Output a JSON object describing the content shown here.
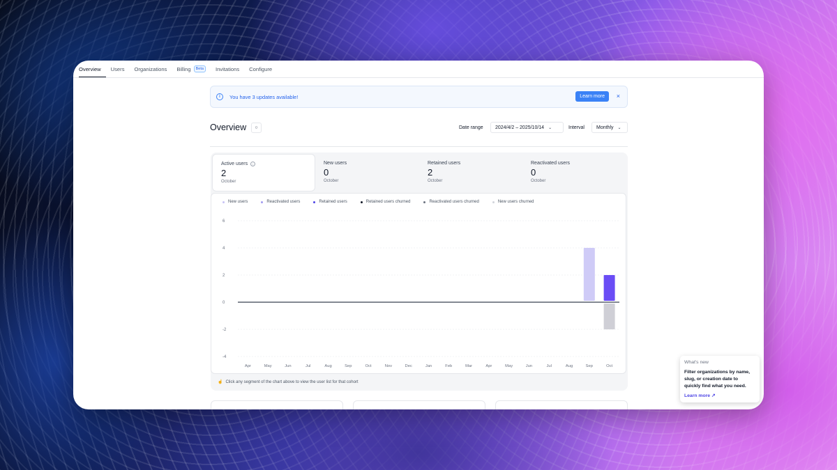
{
  "tabs": [
    {
      "label": "Overview",
      "active": true
    },
    {
      "label": "Users"
    },
    {
      "label": "Organizations"
    },
    {
      "label": "Billing",
      "badge": "Beta"
    },
    {
      "label": "Invitations"
    },
    {
      "label": "Configure"
    }
  ],
  "banner": {
    "icon": "info-icon",
    "text": "You have 3 updates available!",
    "button": "Learn more",
    "close": "×"
  },
  "overview": {
    "title": "Overview",
    "icon": "refresh-icon",
    "date_range_label": "Date range",
    "date_range_value": "2024/4/2 – 2025/10/14",
    "interval_label": "Interval",
    "interval_value": "Monthly"
  },
  "metrics": [
    {
      "label": "Active users",
      "value": "2",
      "sub": "October",
      "active": true,
      "info": true
    },
    {
      "label": "New users",
      "value": "0",
      "sub": "October"
    },
    {
      "label": "Retained users",
      "value": "2",
      "sub": "October"
    },
    {
      "label": "Reactivated users",
      "value": "0",
      "sub": "October"
    }
  ],
  "legend": [
    {
      "label": "New users",
      "color": "#c7c3f5"
    },
    {
      "label": "Reactivated users",
      "color": "#a29bf0"
    },
    {
      "label": "Retained users",
      "color": "#4f46e5"
    },
    {
      "label": "Retained users churned",
      "color": "#111827"
    },
    {
      "label": "Reactivated users churned",
      "color": "#6b7280"
    },
    {
      "label": "New users churned",
      "color": "#d1d5db"
    }
  ],
  "chart_data": {
    "type": "bar",
    "categories": [
      "Apr",
      "May",
      "Jun",
      "Jul",
      "Aug",
      "Sep",
      "Oct",
      "Nov",
      "Dec",
      "Jan",
      "Feb",
      "Mar",
      "Apr",
      "May",
      "Jun",
      "Jul",
      "Aug",
      "Sep",
      "Oct"
    ],
    "yticks": [
      "6",
      "4",
      "2",
      "0",
      "-2",
      "-4"
    ],
    "ylim": [
      -4,
      6
    ],
    "series": [
      {
        "name": "New users",
        "color": "#cfcbf7",
        "values": [
          0,
          0,
          0,
          0,
          0,
          0,
          0,
          0,
          0,
          0,
          0,
          0,
          0,
          0,
          0,
          0,
          0,
          4,
          0
        ]
      },
      {
        "name": "Retained users",
        "color": "#6a4df5",
        "values": [
          0,
          0,
          0,
          0,
          0,
          0,
          0,
          0,
          0,
          0,
          0,
          0,
          0,
          0,
          0,
          0,
          0,
          0,
          2
        ]
      },
      {
        "name": "New users churned",
        "color": "#cfcfd6",
        "values": [
          0,
          0,
          0,
          0,
          0,
          0,
          0,
          0,
          0,
          0,
          0,
          0,
          0,
          0,
          0,
          0,
          0,
          0,
          -2
        ]
      }
    ]
  },
  "hint": {
    "icon": "pointer-icon",
    "text": "Click any segment of the chart above to view the user list for that cohort"
  },
  "whats_new": {
    "title": "What's new",
    "text": "Filter organizations by name, slug, or creation date to quickly find what you need.",
    "link": "Learn more",
    "link_icon": "↗"
  }
}
